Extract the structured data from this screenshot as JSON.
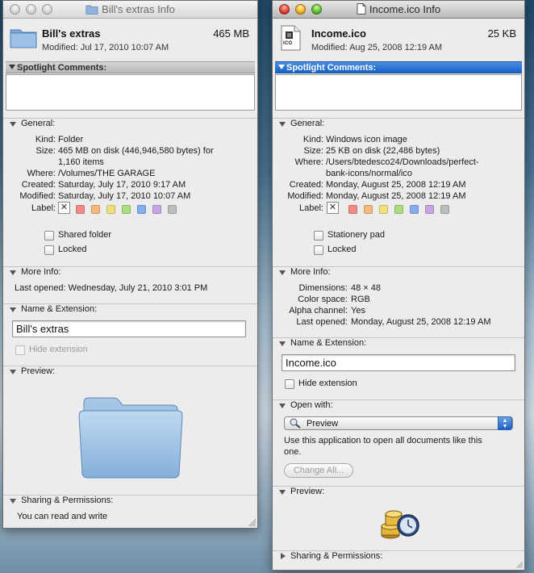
{
  "windows": [
    {
      "title": "Bill's extras Info",
      "file_name": "Bill's extras",
      "file_size": "465 MB",
      "modified": "Modified: Jul 17, 2010 10:07 AM",
      "spotlight_label": "Spotlight Comments:",
      "general": {
        "header": "General:",
        "kind_label": "Kind:",
        "kind": "Folder",
        "size_label": "Size:",
        "size_line1": "465 MB on disk (446,946,580 bytes) for",
        "size_line2": "1,160 items",
        "where_label": "Where:",
        "where": "/Volumes/THE GARAGE",
        "created_label": "Created:",
        "created": "Saturday, July 17, 2010 9:17 AM",
        "modified_label": "Modified:",
        "modified": "Saturday, July 17, 2010 10:07 AM",
        "label_label": "Label:",
        "x_mark": "✕",
        "shared_folder": "Shared folder",
        "locked": "Locked"
      },
      "more_info": {
        "header": "More Info:",
        "last_opened": "Last opened: Wednesday, July 21, 2010 3:01 PM"
      },
      "name_ext": {
        "header": "Name & Extension:",
        "value": "Bill's extras",
        "hide_extension": "Hide extension"
      },
      "preview": {
        "header": "Preview:"
      },
      "sharing": {
        "header": "Sharing & Permissions:",
        "text": "You can read and write"
      }
    },
    {
      "title": "Income.ico Info",
      "file_name": "Income.ico",
      "file_size": "25 KB",
      "modified": "Modified: Aug 25, 2008 12:19 AM",
      "icon_badge": "ICO",
      "spotlight_label": "Spotlight Comments:",
      "general": {
        "header": "General:",
        "kind_label": "Kind:",
        "kind": "Windows icon image",
        "size_label": "Size:",
        "size": "25 KB on disk (22,486 bytes)",
        "where_label": "Where:",
        "where_line1": "/Users/btedesco24/Downloads/perfect-",
        "where_line2": "bank-icons/normal/ico",
        "created_label": "Created:",
        "created": "Monday, August 25, 2008 12:19 AM",
        "modified_label": "Modified:",
        "modified": "Monday, August 25, 2008 12:19 AM",
        "label_label": "Label:",
        "x_mark": "✕",
        "stationery_pad": "Stationery pad",
        "locked": "Locked"
      },
      "more_info": {
        "header": "More Info:",
        "dimensions_label": "Dimensions:",
        "dimensions": "48 × 48",
        "color_space_label": "Color space:",
        "color_space": "RGB",
        "alpha_label": "Alpha channel:",
        "alpha": "Yes",
        "last_opened_label": "Last opened:",
        "last_opened": "Monday, August 25, 2008 12:19 AM"
      },
      "name_ext": {
        "header": "Name & Extension:",
        "value": "Income.ico",
        "hide_extension": "Hide extension"
      },
      "open_with": {
        "header": "Open with:",
        "app": "Preview",
        "description_line1": "Use this application to open all documents like this",
        "description_line2": "one.",
        "change_all": "Change All..."
      },
      "preview": {
        "header": "Preview:"
      },
      "sharing": {
        "header": "Sharing & Permissions:"
      }
    }
  ],
  "label_colors": [
    "#f08a84",
    "#f7b87a",
    "#efe07a",
    "#a9dd7e",
    "#85aef0",
    "#c9a4e4",
    "#bdbdbd"
  ],
  "colors": {
    "selected_section": "#2a76d8",
    "window_bg": "#ececec"
  }
}
